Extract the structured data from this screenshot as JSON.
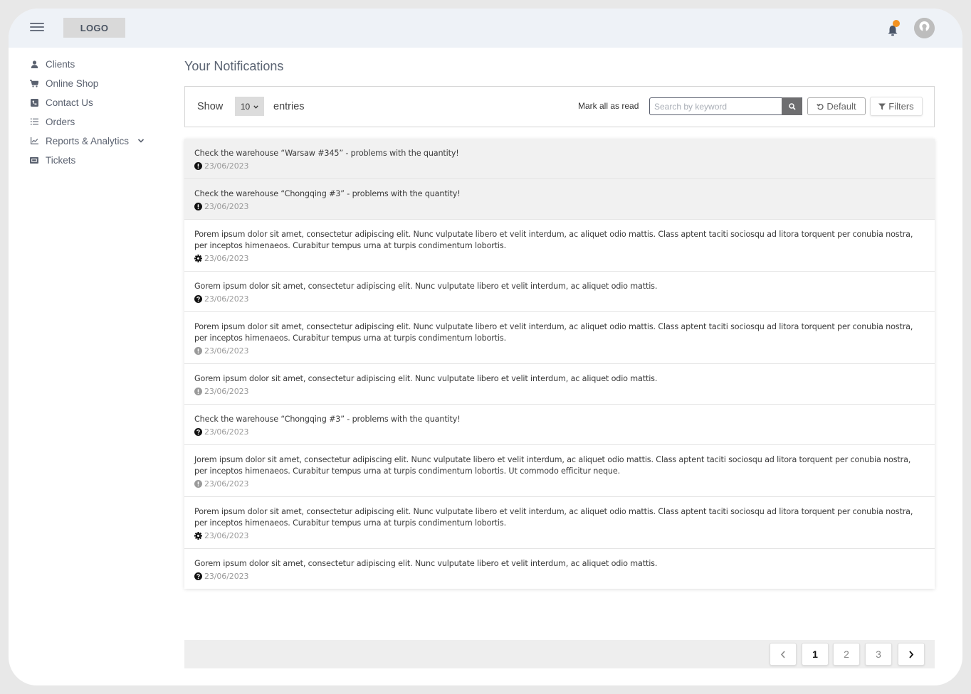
{
  "header": {
    "logo": "LOGO",
    "menu_icon": "hamburger-icon",
    "notification_icon": "bell-icon",
    "notification_dot_color": "#f39221",
    "avatar_icon": "user-avatar-icon"
  },
  "sidebar": {
    "items": [
      {
        "label": "Clients",
        "icon": "user-icon"
      },
      {
        "label": "Online Shop",
        "icon": "cart-icon"
      },
      {
        "label": "Contact Us",
        "icon": "phone-icon"
      },
      {
        "label": "Orders",
        "icon": "list-icon"
      },
      {
        "label": "Reports & Analytics",
        "icon": "chart-line-icon",
        "expandable": true
      },
      {
        "label": "Tickets",
        "icon": "ticket-icon"
      }
    ]
  },
  "main": {
    "title": "Your Notifications",
    "toolbar": {
      "show_label": "Show",
      "entries_value": "10",
      "entries_label": "entries",
      "mark_all_read": "Mark all as read",
      "search_placeholder": "Search by keyword",
      "search_value": "",
      "default_label": "Default",
      "filters_label": "Filters"
    },
    "notifications": [
      {
        "text": "Check the warehouse “Warsaw #345” - problems with the quantity!",
        "date": "23/06/2023",
        "icon": "exclamation-circle-icon",
        "icon_color": "#111111",
        "unread": true
      },
      {
        "text": "Check the warehouse “Chongqing #3” - problems with the quantity!",
        "date": "23/06/2023",
        "icon": "exclamation-circle-icon",
        "icon_color": "#111111",
        "unread": true
      },
      {
        "text": "Porem ipsum dolor sit amet, consectetur adipiscing elit. Nunc vulputate libero et velit interdum, ac aliquet odio mattis. Class aptent taciti sociosqu ad litora torquent per conubia nostra, per inceptos himenaeos. Curabitur tempus urna at turpis condimentum lobortis.",
        "date": "23/06/2023",
        "icon": "gear-icon",
        "icon_color": "#111111",
        "unread": false
      },
      {
        "text": "Gorem ipsum dolor sit amet, consectetur adipiscing elit. Nunc vulputate libero et velit interdum, ac aliquet odio mattis.",
        "date": "23/06/2023",
        "icon": "question-circle-icon",
        "icon_color": "#111111",
        "unread": false
      },
      {
        "text": "Porem ipsum dolor sit amet, consectetur adipiscing elit. Nunc vulputate libero et velit interdum, ac aliquet odio mattis. Class aptent taciti sociosqu ad litora torquent per conubia nostra, per inceptos himenaeos. Curabitur tempus urna at turpis condimentum lobortis.",
        "date": "23/06/2023",
        "icon": "exclamation-circle-icon",
        "icon_color": "#9a9a9a",
        "unread": false
      },
      {
        "text": "Gorem ipsum dolor sit amet, consectetur adipiscing elit. Nunc vulputate libero et velit interdum, ac aliquet odio mattis.",
        "date": "23/06/2023",
        "icon": "exclamation-circle-icon",
        "icon_color": "#9a9a9a",
        "unread": false
      },
      {
        "text": "Check the warehouse “Chongqing #3” - problems with the quantity!",
        "date": "23/06/2023",
        "icon": "question-circle-icon",
        "icon_color": "#111111",
        "unread": false
      },
      {
        "text": "Jorem ipsum dolor sit amet, consectetur adipiscing elit. Nunc vulputate libero et velit interdum, ac aliquet odio mattis. Class aptent taciti sociosqu ad litora torquent per conubia nostra, per inceptos himenaeos. Curabitur tempus urna at turpis condimentum lobortis. Ut commodo efficitur neque.",
        "date": "23/06/2023",
        "icon": "exclamation-circle-icon",
        "icon_color": "#9a9a9a",
        "unread": false
      },
      {
        "text": "Porem ipsum dolor sit amet, consectetur adipiscing elit. Nunc vulputate libero et velit interdum, ac aliquet odio mattis. Class aptent taciti sociosqu ad litora torquent per conubia nostra, per inceptos himenaeos. Curabitur tempus urna at turpis condimentum lobortis.",
        "date": "23/06/2023",
        "icon": "gear-icon",
        "icon_color": "#111111",
        "unread": false
      },
      {
        "text": "Gorem ipsum dolor sit amet, consectetur adipiscing elit. Nunc vulputate libero et velit interdum, ac aliquet odio mattis.",
        "date": "23/06/2023",
        "icon": "question-circle-icon",
        "icon_color": "#111111",
        "unread": false
      }
    ],
    "pagination": {
      "prev_icon": "chevron-left-icon",
      "next_icon": "chevron-right-icon",
      "pages": [
        "1",
        "2",
        "3"
      ],
      "current": "1"
    }
  }
}
